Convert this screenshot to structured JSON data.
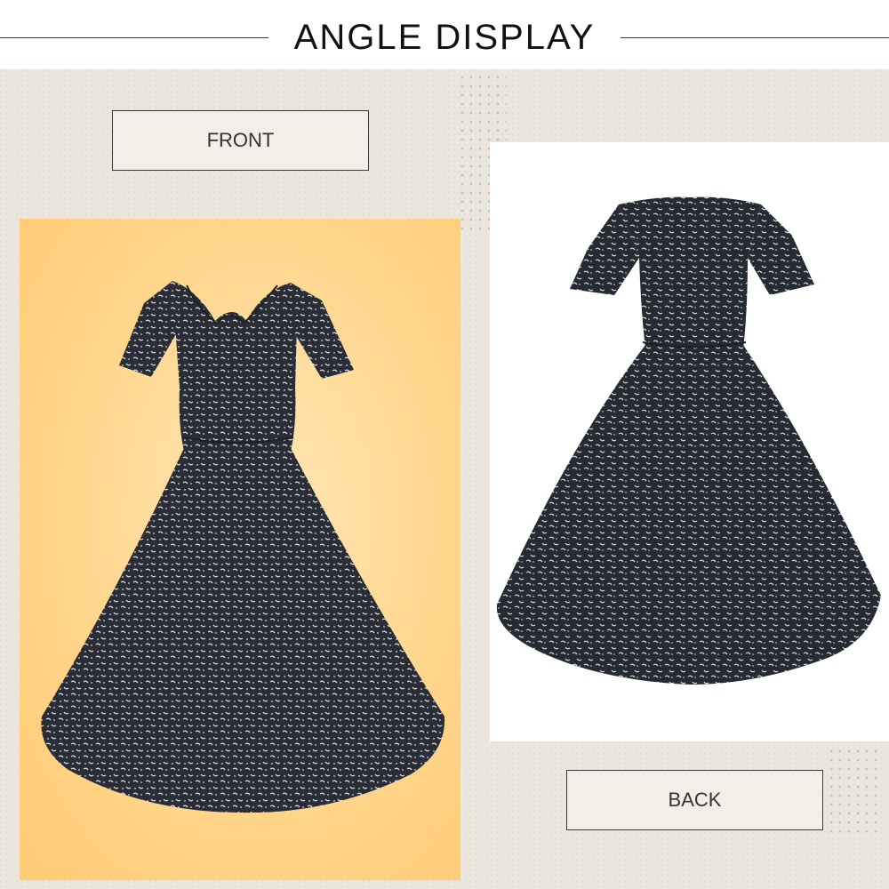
{
  "header": {
    "title": "ANGLE DISPLAY"
  },
  "labels": {
    "front": "FRONT",
    "back": "BACK"
  },
  "colors": {
    "panel_background": "#ece7de",
    "front_backdrop": "#ffd68c",
    "back_backdrop": "#ffffff",
    "dress_base": "#2a2d36",
    "dress_print": "#d9dbe0"
  },
  "images": [
    {
      "name": "dress-front-photo",
      "description_icon": "dress-icon"
    },
    {
      "name": "dress-back-photo",
      "description_icon": "dress-icon"
    }
  ]
}
